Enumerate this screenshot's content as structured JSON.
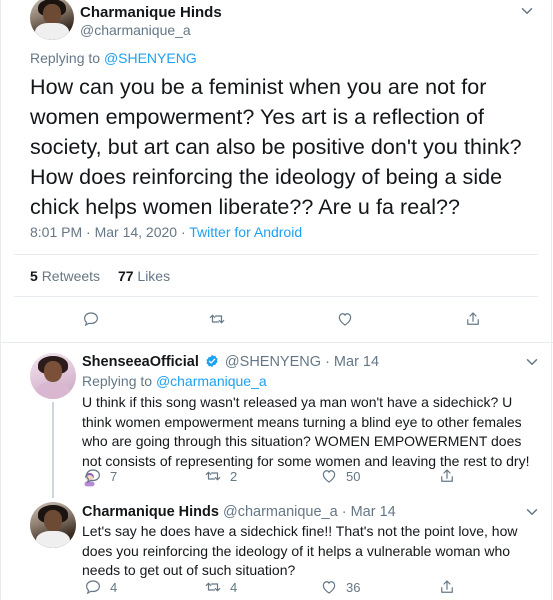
{
  "main_tweet": {
    "author_name": "Charmanique Hinds",
    "author_handle": "@charmanique_a",
    "replying_label": "Replying to",
    "replying_to": "@SHENYENG",
    "text": "How can you be a feminist when you are not for women empowerment? Yes art is a reflection of society, but art can also be positive don't you think? How does reinforcing the ideology of being a side chick helps women liberate?? Are u fa real??",
    "timestamp": "8:01 PM · Mar 14, 2020 ·",
    "source": "Twitter for Android",
    "retweets_count": "5",
    "retweets_label": "Retweets",
    "likes_count": "77",
    "likes_label": "Likes"
  },
  "replies": [
    {
      "author_name": "ShenseeaOfficial",
      "author_handle": "@SHENYENG",
      "date": "· Mar 14",
      "verified": true,
      "replying_label": "Replying to",
      "replying_to": "@charmanique_a",
      "text": "U think if this song wasn't released ya man won't have a sidechick? U think women empowerment means turning a blind eye to other females who are going through this situation? WOMEN EMPOWERMENT does not consists of representing for some women and leaving the rest to dry!",
      "emoji": "woman-facepalming-emoji",
      "reply_count": "7",
      "retweet_count": "2",
      "like_count": "50"
    },
    {
      "author_name": "Charmanique Hinds",
      "author_handle": "@charmanique_a",
      "date": "· Mar 14",
      "verified": false,
      "text": "Let's say he does have a sidechick fine!! That's not the point love, how does you reinforcing the ideology of it helps a vulnerable woman who needs to get out of such situation?",
      "reply_count": "4",
      "retweet_count": "4",
      "like_count": "36"
    }
  ],
  "icons": {
    "caret": "chevron-down-icon",
    "reply": "comment-icon",
    "retweet": "retweet-icon",
    "like": "heart-icon",
    "share": "share-icon",
    "verified": "verified-badge-icon"
  },
  "colors": {
    "accent": "#1da1f2",
    "text": "#14171a",
    "secondary": "#657786",
    "divider": "#e6ecf0"
  }
}
